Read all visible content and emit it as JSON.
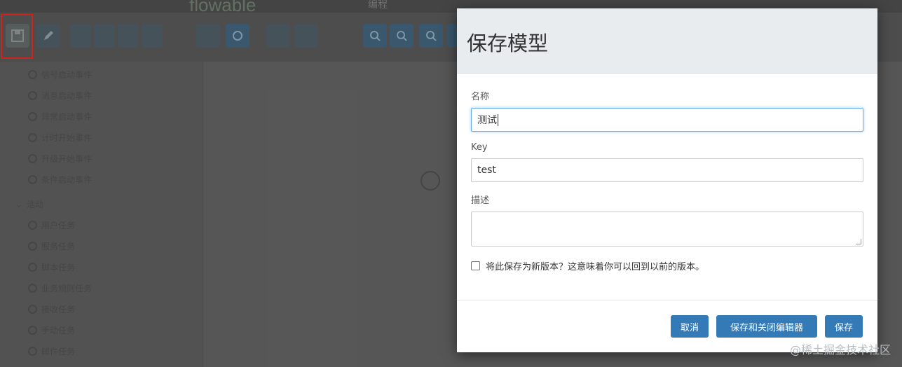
{
  "background": {
    "logo_text": "flowable",
    "nav_items": [
      "编程"
    ],
    "palette": {
      "items": [
        "信号启动事件",
        "消息启动事件",
        "异常启动事件",
        "计时开始事件",
        "升级开始事件",
        "条件启动事件"
      ],
      "group_label": "活动",
      "group_items": [
        "用户任务",
        "服务任务",
        "脚本任务",
        "业务规则任务",
        "接收任务",
        "手动任务",
        "邮件任务"
      ]
    }
  },
  "modal": {
    "title": "保存模型",
    "name_label": "名称",
    "name_value": "测试",
    "key_label": "Key",
    "key_value": "test",
    "desc_label": "描述",
    "desc_value": "",
    "new_version_label": "将此保存为新版本？这意味着你可以回到以前的版本。",
    "new_version_checked": false,
    "buttons": {
      "cancel": "取消",
      "save_close": "保存和关闭编辑器",
      "save": "保存"
    }
  },
  "watermark": "@稀土掘金技术社区",
  "colors": {
    "primary_button": "#337ab7",
    "header_bg": "#e8ecef",
    "highlight_border": "#e0281e",
    "focus_border": "#66afe9"
  }
}
